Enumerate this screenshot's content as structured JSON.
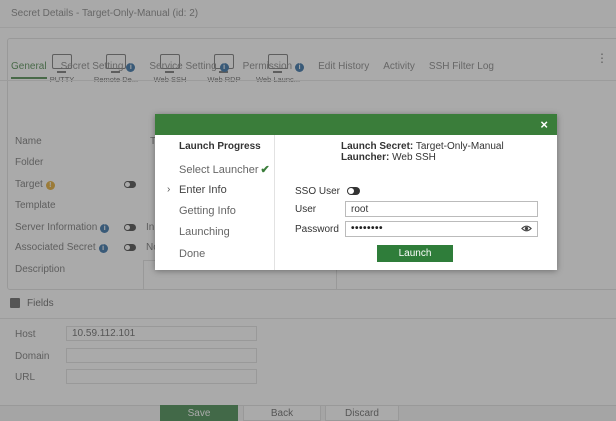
{
  "page": {
    "title": "Secret Details - Target-Only-Manual (id: 2)"
  },
  "launchers": [
    {
      "label": "PUTTY",
      "icon": "monitor-icon"
    },
    {
      "label": "Remote De...",
      "icon": "monitor-icon"
    },
    {
      "label": "Web SSH",
      "icon": "monitor-icon"
    },
    {
      "label": "Web RDP",
      "icon": "monitor-icon"
    },
    {
      "label": "Web Launc...",
      "icon": "monitor-icon"
    }
  ],
  "tabs": [
    {
      "label": "General",
      "info": false
    },
    {
      "label": "Secret Setting",
      "info": true
    },
    {
      "label": "Service Setting",
      "info": true
    },
    {
      "label": "Permission",
      "info": true
    },
    {
      "label": "Edit History",
      "info": false
    },
    {
      "label": "Activity",
      "info": false
    },
    {
      "label": "SSH Filter Log",
      "info": false
    }
  ],
  "form": {
    "name_label": "Name",
    "name_value": "T",
    "folder_label": "Folder",
    "target_label": "Target",
    "template_label": "Template",
    "server_info_label": "Server Information",
    "server_info_value": "Inh",
    "assoc_secret_label": "Associated Secret",
    "assoc_secret_value": "No",
    "description_label": "Description"
  },
  "fields": {
    "title": "Fields",
    "host_label": "Host",
    "host_value": "10.59.112.101",
    "domain_label": "Domain",
    "url_label": "URL"
  },
  "footer": {
    "save": "Save",
    "back": "Back",
    "discard": "Discard"
  },
  "modal": {
    "close": "×",
    "progress_title": "Launch Progress",
    "steps": [
      "Select Launcher",
      "Enter Info",
      "Getting Info",
      "Launching",
      "Done"
    ],
    "current_step_marker": "›",
    "completed_mark": "✔",
    "launch_secret_label": "Launch Secret:",
    "launch_secret_value": "Target-Only-Manual",
    "launcher_label": "Launcher:",
    "launcher_value": "Web SSH",
    "sso_user_label": "SSO User",
    "user_label": "User",
    "user_value": "root",
    "password_label": "Password",
    "password_masked": "••••••••",
    "launch_button": "Launch"
  },
  "colors": {
    "accent": "#3a7d3a",
    "button": "#2f7d3a",
    "info": "#1d5f9a",
    "warn": "#e0a11a"
  }
}
